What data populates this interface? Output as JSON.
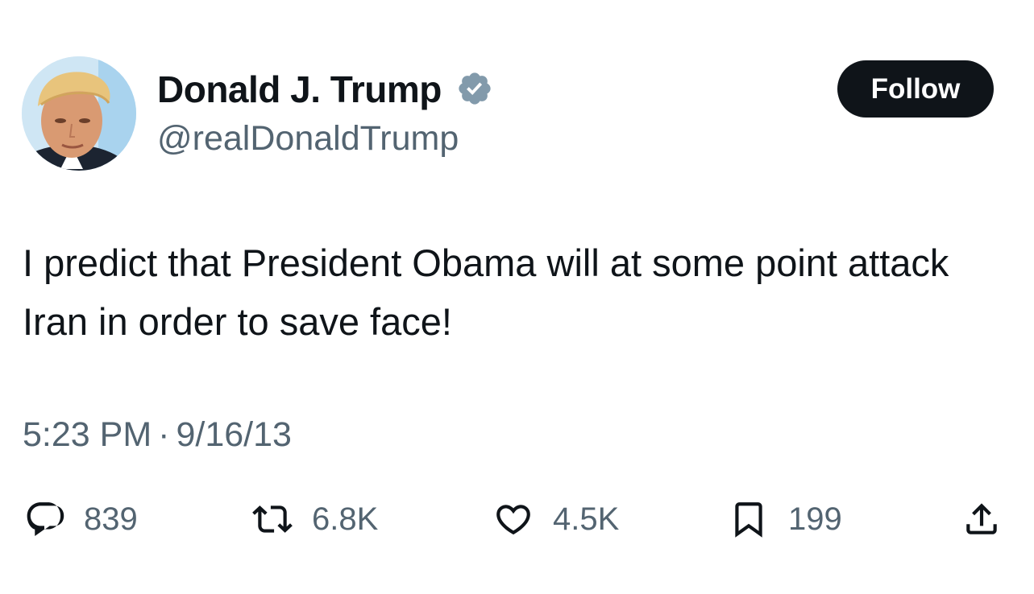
{
  "user": {
    "display_name": "Donald J. Trump",
    "handle": "@realDonaldTrump",
    "verified_icon": "verified-badge-icon"
  },
  "follow_label": "Follow",
  "tweet": {
    "text": "I predict that President Obama will at some point attack Iran in order to save face!",
    "time": "5:23 PM",
    "separator": "·",
    "date": "9/16/13"
  },
  "actions": {
    "replies": "839",
    "reposts": "6.8K",
    "likes": "4.5K",
    "bookmarks": "199"
  },
  "colors": {
    "text": "#0f1419",
    "secondary": "#536471",
    "verified": "#829aab",
    "highlight": "#fbf59a",
    "follow_bg": "#0f1419"
  }
}
